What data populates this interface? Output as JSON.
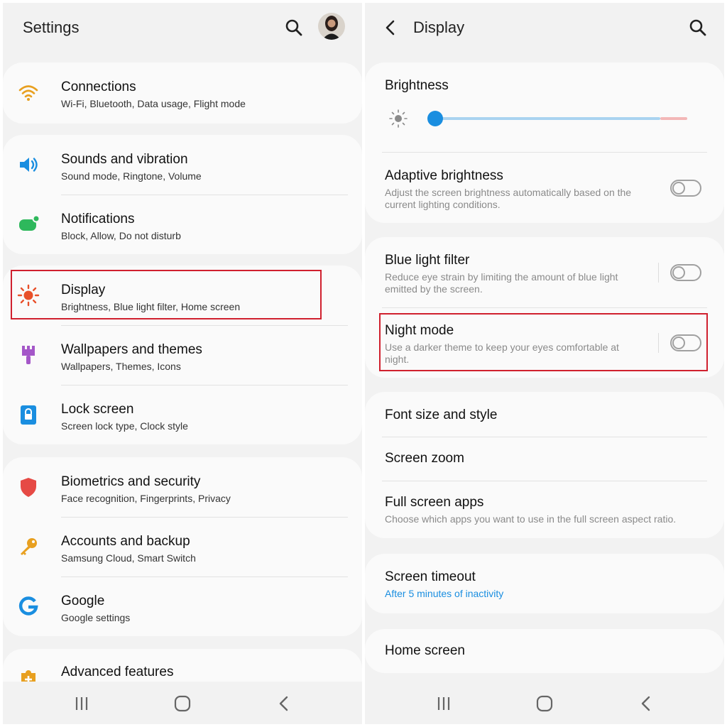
{
  "left": {
    "title": "Settings",
    "items": [
      {
        "label": "Connections",
        "sub": "Wi-Fi, Bluetooth, Data usage, Flight mode"
      },
      {
        "label": "Sounds and vibration",
        "sub": "Sound mode, Ringtone, Volume"
      },
      {
        "label": "Notifications",
        "sub": "Block, Allow, Do not disturb"
      },
      {
        "label": "Display",
        "sub": "Brightness, Blue light filter, Home screen"
      },
      {
        "label": "Wallpapers and themes",
        "sub": "Wallpapers, Themes, Icons"
      },
      {
        "label": "Lock screen",
        "sub": "Screen lock type, Clock style"
      },
      {
        "label": "Biometrics and security",
        "sub": "Face recognition, Fingerprints, Privacy"
      },
      {
        "label": "Accounts and backup",
        "sub": "Samsung Cloud, Smart Switch"
      },
      {
        "label": "Google",
        "sub": "Google settings"
      },
      {
        "label": "Advanced features",
        "sub": ""
      }
    ]
  },
  "right": {
    "title": "Display",
    "brightness": {
      "label": "Brightness",
      "level": 0.0
    },
    "adaptive": {
      "label": "Adaptive brightness",
      "desc": "Adjust the screen brightness automatically based on the current lighting conditions.",
      "on": false
    },
    "blue_light": {
      "label": "Blue light filter",
      "desc": "Reduce eye strain by limiting the amount of blue light emitted by the screen.",
      "on": false
    },
    "night_mode": {
      "label": "Night mode",
      "desc": "Use a darker theme to keep your eyes comfortable at night.",
      "on": false
    },
    "font": {
      "label": "Font size and style"
    },
    "zoom": {
      "label": "Screen zoom"
    },
    "fullscreen": {
      "label": "Full screen apps",
      "desc": "Choose which apps you want to use in the full screen aspect ratio."
    },
    "timeout": {
      "label": "Screen timeout",
      "value": "After 5 minutes of inactivity"
    },
    "home": {
      "label": "Home screen"
    }
  },
  "colors": {
    "accent": "#1a8ee0",
    "highlight": "#d0202e",
    "toggle_off": "#a0a0a0"
  }
}
